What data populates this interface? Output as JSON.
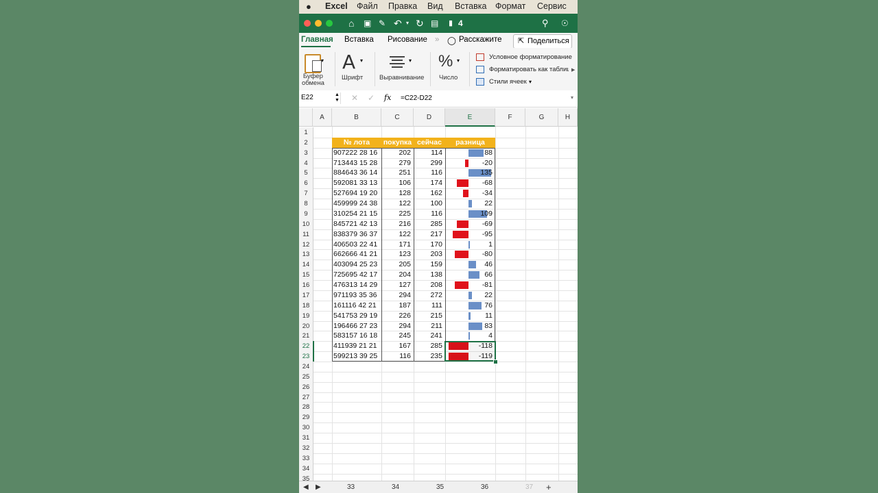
{
  "menubar": {
    "items": [
      "Excel",
      "Файл",
      "Правка",
      "Вид",
      "Вставка",
      "Формат",
      "Сервис"
    ]
  },
  "window": {
    "doc_name": "4"
  },
  "ribbon": {
    "tabs": [
      "Главная",
      "Вставка",
      "Рисование"
    ],
    "tell_me": "Расскажите",
    "share_label": "Поделиться",
    "groups": {
      "clipboard": [
        "Буфер",
        "обмена"
      ],
      "font": "Шрифт",
      "align": "Выравнивание",
      "number": "Число"
    },
    "styles": [
      "Условное форматирование",
      "Форматировать как таблицу",
      "Стили ячеек"
    ]
  },
  "formula_bar": {
    "name_box": "E22",
    "fx": "fx",
    "formula": "=C22-D22"
  },
  "grid": {
    "columns": [
      "A",
      "B",
      "C",
      "D",
      "E",
      "F",
      "G",
      "H"
    ],
    "rows": [
      "1",
      "2",
      "3",
      "4",
      "5",
      "6",
      "7",
      "8",
      "9",
      "10",
      "11",
      "12",
      "13",
      "14",
      "15",
      "16",
      "17",
      "18",
      "19",
      "20",
      "21",
      "22",
      "23",
      "24",
      "25",
      "26",
      "27",
      "28",
      "29",
      "30",
      "31",
      "32",
      "33",
      "34",
      "35"
    ],
    "headers": {
      "b": "№ лота",
      "c": "покупка",
      "d": "сейчас",
      "e": "разница"
    },
    "data": [
      {
        "lot": "907222 28 16",
        "buy": 202,
        "now": 114,
        "diff": 88
      },
      {
        "lot": "713443 15 28",
        "buy": 279,
        "now": 299,
        "diff": -20
      },
      {
        "lot": "884643 36 14",
        "buy": 251,
        "now": 116,
        "diff": 135
      },
      {
        "lot": "592081 33 13",
        "buy": 106,
        "now": 174,
        "diff": -68
      },
      {
        "lot": "527694 19 20",
        "buy": 128,
        "now": 162,
        "diff": -34
      },
      {
        "lot": "459999 24 38",
        "buy": 122,
        "now": 100,
        "diff": 22
      },
      {
        "lot": "310254 21 15",
        "buy": 225,
        "now": 116,
        "diff": 109
      },
      {
        "lot": "845721 42 13",
        "buy": 216,
        "now": 285,
        "diff": -69
      },
      {
        "lot": "838379 36 37",
        "buy": 122,
        "now": 217,
        "diff": -95
      },
      {
        "lot": "406503 22 41",
        "buy": 171,
        "now": 170,
        "diff": 1
      },
      {
        "lot": "662666 41 21",
        "buy": 123,
        "now": 203,
        "diff": -80
      },
      {
        "lot": "403094 25 23",
        "buy": 205,
        "now": 159,
        "diff": 46
      },
      {
        "lot": "725695 42 17",
        "buy": 204,
        "now": 138,
        "diff": 66
      },
      {
        "lot": "476313 14 29",
        "buy": 127,
        "now": 208,
        "diff": -81
      },
      {
        "lot": "971193 35 36",
        "buy": 294,
        "now": 272,
        "diff": 22
      },
      {
        "lot": "161116 42 21",
        "buy": 187,
        "now": 111,
        "diff": 76
      },
      {
        "lot": "541753 29 19",
        "buy": 226,
        "now": 215,
        "diff": 11
      },
      {
        "lot": "196466 27 23",
        "buy": 294,
        "now": 211,
        "diff": 83
      },
      {
        "lot": "583157 16 18",
        "buy": 245,
        "now": 241,
        "diff": 4
      },
      {
        "lot": "411939 21 21",
        "buy": 167,
        "now": 285,
        "diff": -118
      },
      {
        "lot": "599213 39 25",
        "buy": 116,
        "now": 235,
        "diff": -119
      }
    ]
  },
  "sheet_tabs": [
    "33",
    "34",
    "35",
    "36",
    "37"
  ],
  "colors": {
    "positive_bar": "#6a8fc7",
    "negative_bar": "#e0121b",
    "header_fill": "#f2b21b",
    "title_bar": "#1e7145"
  }
}
